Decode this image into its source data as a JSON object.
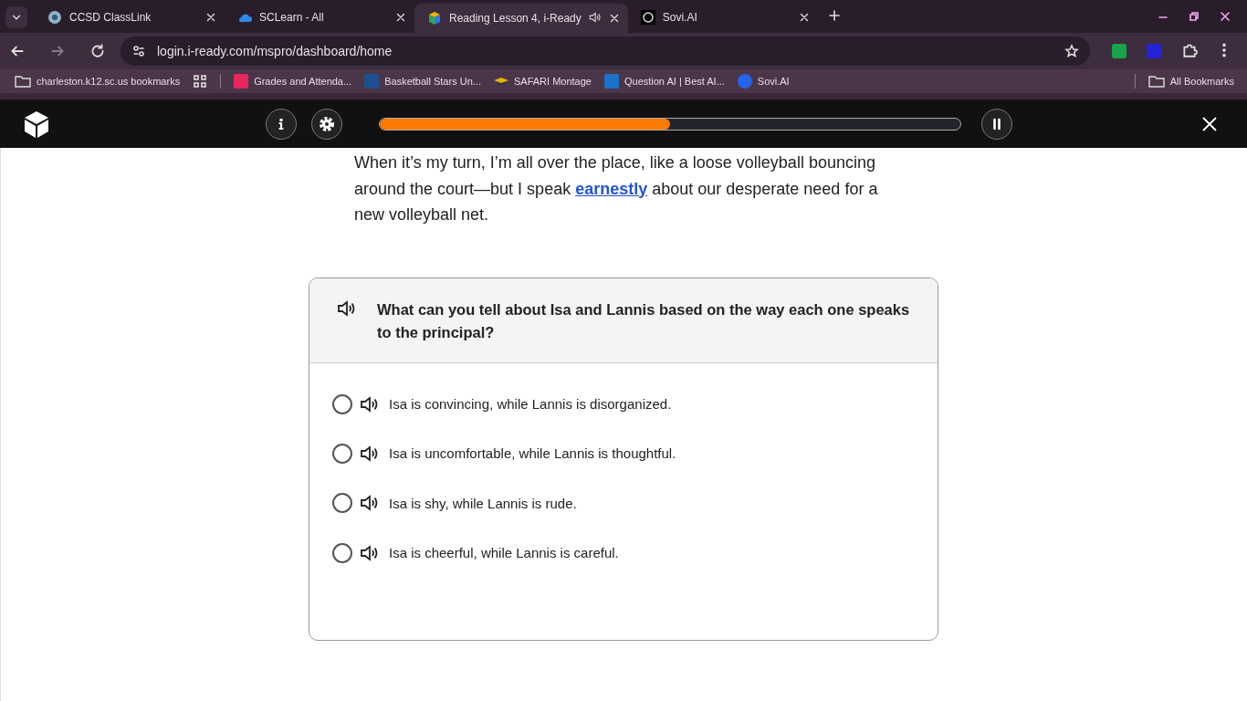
{
  "browser": {
    "tabs": [
      {
        "title": "CCSD ClassLink",
        "selected": false,
        "audio": false
      },
      {
        "title": "SCLearn - All",
        "selected": false,
        "audio": false
      },
      {
        "title": "Reading Lesson 4, i-Ready",
        "selected": true,
        "audio": true
      },
      {
        "title": "Sovi.AI",
        "selected": false,
        "audio": false
      }
    ],
    "address": "login.i-ready.com/mspro/dashboard/home",
    "bookmarks": [
      {
        "label": "charleston.k12.sc.us bookmarks"
      },
      {
        "label": "Grades and Attenda..."
      },
      {
        "label": "Basketball Stars Un..."
      },
      {
        "label": "SAFARI Montage"
      },
      {
        "label": "Question AI | Best AI..."
      },
      {
        "label": "Sovi.AI"
      }
    ],
    "all_bookmarks": "All Bookmarks"
  },
  "lesson": {
    "progress": {
      "level": 0.5
    },
    "passage": "When it’s my turn, I’m all over the place, like a loose volleyball bouncing around the court—but I speak **earnestly** about our desperate need for a new volleyball net.",
    "question": "What can you tell about Isa and Lannis based on the way each one speaks to the principal?",
    "options": [
      {
        "text": "Isa is convincing, while Lannis is disorganized.",
        "selected": false
      },
      {
        "text": "Isa is uncomfortable, while Lannis is thoughtful.",
        "selected": false
      },
      {
        "text": "Isa is shy, while Lannis is rude.",
        "selected": false
      },
      {
        "text": "Isa is cheerful, while Lannis is careful.",
        "selected": false
      }
    ]
  }
}
